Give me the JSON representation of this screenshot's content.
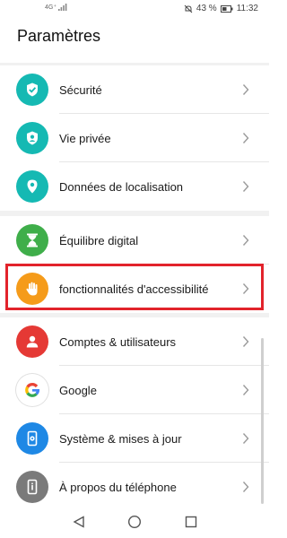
{
  "status_bar": {
    "signal_text": "4G⁺",
    "battery": "43 %",
    "time": "11:32"
  },
  "header": {
    "title": "Paramètres"
  },
  "groups": [
    {
      "items": [
        {
          "label": "Sécurité",
          "icon": "shield-check-icon",
          "color": "#15b9b3"
        },
        {
          "label": "Vie privée",
          "icon": "shield-user-icon",
          "color": "#15b9b3"
        },
        {
          "label": "Données de localisation",
          "icon": "location-pin-icon",
          "color": "#15b9b3"
        }
      ]
    },
    {
      "items": [
        {
          "label": "Équilibre digital",
          "icon": "hourglass-icon",
          "color": "#3fae4a"
        },
        {
          "label": "fonctionnalités d'accessibilité",
          "icon": "hand-icon",
          "color": "#f59b1a",
          "highlighted": true
        }
      ]
    },
    {
      "items": [
        {
          "label": "Comptes & utilisateurs",
          "icon": "user-icon",
          "color": "#e53935"
        },
        {
          "label": "Google",
          "icon": "google-icon",
          "color": "#ffffff"
        },
        {
          "label": "Système & mises à jour",
          "icon": "phone-gear-icon",
          "color": "#1e88e5"
        },
        {
          "label": "À propos du téléphone",
          "icon": "phone-info-icon",
          "color": "#7a7a7a"
        }
      ]
    }
  ],
  "highlight_color": "#e2232b",
  "nav": {
    "back": "back-icon",
    "home": "home-icon",
    "recents": "recents-icon"
  }
}
